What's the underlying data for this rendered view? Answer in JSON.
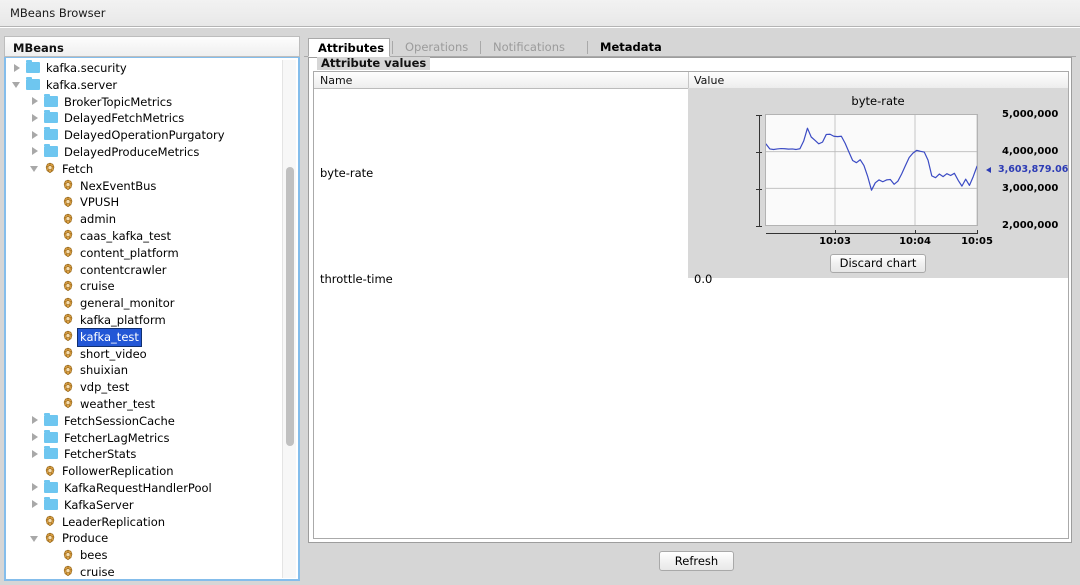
{
  "window": {
    "title": "MBeans Browser"
  },
  "tree": {
    "header": "MBeans",
    "items": [
      {
        "label": "kafka.security",
        "indent": 0,
        "twisty": "right",
        "icon": "folder-icon",
        "selected": false
      },
      {
        "label": "kafka.server",
        "indent": 0,
        "twisty": "down",
        "icon": "folder-icon",
        "selected": false
      },
      {
        "label": "BrokerTopicMetrics",
        "indent": 1,
        "twisty": "right",
        "icon": "folder-icon",
        "selected": false
      },
      {
        "label": "DelayedFetchMetrics",
        "indent": 1,
        "twisty": "right",
        "icon": "folder-icon",
        "selected": false
      },
      {
        "label": "DelayedOperationPurgatory",
        "indent": 1,
        "twisty": "right",
        "icon": "folder-icon",
        "selected": false
      },
      {
        "label": "DelayedProduceMetrics",
        "indent": 1,
        "twisty": "right",
        "icon": "folder-icon",
        "selected": false
      },
      {
        "label": "Fetch",
        "indent": 1,
        "twisty": "down",
        "icon": "mbean-icon",
        "selected": false
      },
      {
        "label": "NexEventBus",
        "indent": 2,
        "twisty": "none",
        "icon": "mbean-icon",
        "selected": false
      },
      {
        "label": "VPUSH",
        "indent": 2,
        "twisty": "none",
        "icon": "mbean-icon",
        "selected": false
      },
      {
        "label": "admin",
        "indent": 2,
        "twisty": "none",
        "icon": "mbean-icon",
        "selected": false
      },
      {
        "label": "caas_kafka_test",
        "indent": 2,
        "twisty": "none",
        "icon": "mbean-icon",
        "selected": false
      },
      {
        "label": "content_platform",
        "indent": 2,
        "twisty": "none",
        "icon": "mbean-icon",
        "selected": false
      },
      {
        "label": "contentcrawler",
        "indent": 2,
        "twisty": "none",
        "icon": "mbean-icon",
        "selected": false
      },
      {
        "label": "cruise",
        "indent": 2,
        "twisty": "none",
        "icon": "mbean-icon",
        "selected": false
      },
      {
        "label": "general_monitor",
        "indent": 2,
        "twisty": "none",
        "icon": "mbean-icon",
        "selected": false
      },
      {
        "label": "kafka_platform",
        "indent": 2,
        "twisty": "none",
        "icon": "mbean-icon",
        "selected": false
      },
      {
        "label": "kafka_test",
        "indent": 2,
        "twisty": "none",
        "icon": "mbean-icon",
        "selected": true
      },
      {
        "label": "short_video",
        "indent": 2,
        "twisty": "none",
        "icon": "mbean-icon",
        "selected": false
      },
      {
        "label": "shuixian",
        "indent": 2,
        "twisty": "none",
        "icon": "mbean-icon",
        "selected": false
      },
      {
        "label": "vdp_test",
        "indent": 2,
        "twisty": "none",
        "icon": "mbean-icon",
        "selected": false
      },
      {
        "label": "weather_test",
        "indent": 2,
        "twisty": "none",
        "icon": "mbean-icon",
        "selected": false
      },
      {
        "label": "FetchSessionCache",
        "indent": 1,
        "twisty": "right",
        "icon": "folder-icon",
        "selected": false
      },
      {
        "label": "FetcherLagMetrics",
        "indent": 1,
        "twisty": "right",
        "icon": "folder-icon",
        "selected": false
      },
      {
        "label": "FetcherStats",
        "indent": 1,
        "twisty": "right",
        "icon": "folder-icon",
        "selected": false
      },
      {
        "label": "FollowerReplication",
        "indent": 1,
        "twisty": "none",
        "icon": "mbean-icon",
        "selected": false
      },
      {
        "label": "KafkaRequestHandlerPool",
        "indent": 1,
        "twisty": "right",
        "icon": "folder-icon",
        "selected": false
      },
      {
        "label": "KafkaServer",
        "indent": 1,
        "twisty": "right",
        "icon": "folder-icon",
        "selected": false
      },
      {
        "label": "LeaderReplication",
        "indent": 1,
        "twisty": "none",
        "icon": "mbean-icon",
        "selected": false
      },
      {
        "label": "Produce",
        "indent": 1,
        "twisty": "down",
        "icon": "mbean-icon",
        "selected": false
      },
      {
        "label": "bees",
        "indent": 2,
        "twisty": "none",
        "icon": "mbean-icon",
        "selected": false
      },
      {
        "label": "cruise",
        "indent": 2,
        "twisty": "none",
        "icon": "mbean-icon",
        "selected": false
      }
    ]
  },
  "tabs": [
    {
      "label": "Attributes",
      "state": "active"
    },
    {
      "label": "Operations",
      "state": "disabled"
    },
    {
      "label": "Notifications",
      "state": "disabled"
    },
    {
      "label": "Metadata",
      "state": "enabled"
    }
  ],
  "attributes_panel": {
    "group_title": "Attribute values",
    "columns": [
      "Name",
      "Value"
    ],
    "rows": [
      {
        "name": "byte-rate",
        "value": ""
      },
      {
        "name": "throttle-time",
        "value": "0.0"
      }
    ]
  },
  "chart_cell": {
    "discard_label": "Discard chart",
    "last_value_label": "3,603,879.0605"
  },
  "footer": {
    "refresh_label": "Refresh"
  },
  "colors": {
    "selection_blue": "#2357d6",
    "line_blue": "#3b4bc4",
    "folder_blue": "#6ec6f0",
    "mbean_orange": "#e3a33a"
  },
  "chart_data": {
    "type": "line",
    "title": "byte-rate",
    "xlabel": "",
    "ylabel": "",
    "ylim": [
      2000000,
      5000000
    ],
    "yticks": [
      5000000,
      4000000,
      3000000,
      2000000
    ],
    "ytick_labels": [
      "5,000,000",
      "4,000,000",
      "3,000,000",
      "2,000,000"
    ],
    "xticks": [
      "10:03",
      "10:04",
      "10:05"
    ],
    "grid": true,
    "legend": "none",
    "annotation": "3,603,879.0605",
    "series": [
      {
        "name": "byte-rate",
        "color": "#3b4bc4",
        "values": [
          4210000,
          4075000,
          4060000,
          4075000,
          4085000,
          4080000,
          4070000,
          4075000,
          4060000,
          4080000,
          4290000,
          4640000,
          4400000,
          4310000,
          4215000,
          4260000,
          4470000,
          4475000,
          4420000,
          4410000,
          4420000,
          4230000,
          3990000,
          3760000,
          3700000,
          3780000,
          3620000,
          3320000,
          2950000,
          3150000,
          3230000,
          3180000,
          3230000,
          3240000,
          3110000,
          3195000,
          3390000,
          3620000,
          3840000,
          3960000,
          4035000,
          4010000,
          3990000,
          3770000,
          3340000,
          3290000,
          3390000,
          3320000,
          3400000,
          3350000,
          3410000,
          3220000,
          3060000,
          3250000,
          3080000,
          3320000,
          3603879
        ]
      }
    ]
  }
}
